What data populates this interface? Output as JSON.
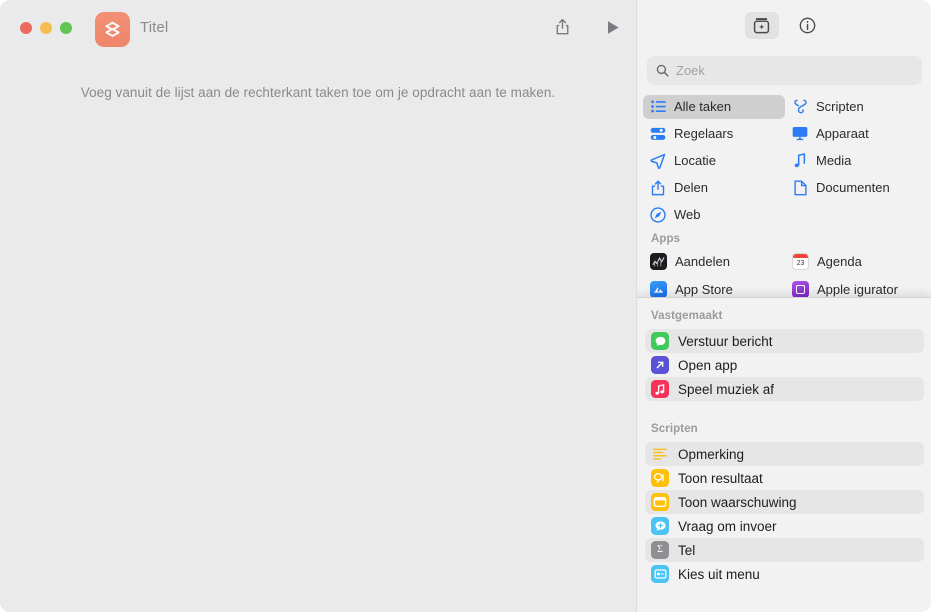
{
  "window": {
    "document_title": "Titel",
    "app_icon_name": "shortcuts-app-icon",
    "traffic_lights": [
      "close",
      "minimize",
      "zoom"
    ],
    "accent_colors": {
      "app_icon": "#ef8a70",
      "category_icon_blue": "#2d7cf6",
      "selected_row": "#cfcfcf",
      "pane_background": "#f2f2f2",
      "editor_background": "#eaeaea"
    }
  },
  "editor": {
    "toolbar": {
      "share_label": "Deel",
      "play_label": "Voer uit"
    },
    "empty_hint": "Voeg vanuit de lijst aan de rechterkant taken toe om je opdracht aan te maken."
  },
  "library": {
    "toolbar": {
      "action_library_label": "Takenbibliotheek",
      "info_label": "Info"
    },
    "search": {
      "placeholder": "Zoek",
      "value": ""
    },
    "categories": [
      {
        "label": "Alle taken",
        "icon": "list-bullet-icon",
        "selected": true
      },
      {
        "label": "Scripten",
        "icon": "scripts-icon",
        "selected": false,
        "display": "Scripten"
      },
      {
        "label": "Regelaars",
        "icon": "sliders-icon",
        "selected": false
      },
      {
        "label": "Apparaat",
        "icon": "display-icon",
        "selected": false
      },
      {
        "label": "Locatie",
        "icon": "location-arrow-icon",
        "selected": false
      },
      {
        "label": "Media",
        "icon": "music-note-icon",
        "selected": false
      },
      {
        "label": "Delen",
        "icon": "share-icon",
        "selected": false
      },
      {
        "label": "Documenten",
        "icon": "document-icon",
        "selected": false
      },
      {
        "label": "Web",
        "icon": "safari-compass-icon",
        "selected": false
      }
    ],
    "categories_display": {
      "c0": "Alle taken",
      "c1": "Scripten",
      "c2": "Regelaars",
      "c3": "Apparaat",
      "c4": "Locatie",
      "c5": "Media",
      "c6": "Delen",
      "c7": "Documenten",
      "c8": "Web"
    },
    "apps_section": {
      "header": "Apps",
      "items": [
        {
          "label": "Aandelen",
          "icon": "stocks-app-icon",
          "color": "#1c1c1e"
        },
        {
          "label": "Agenda",
          "icon": "calendar-app-icon",
          "color": "#ffffff",
          "badge": "23"
        },
        {
          "label": "App Store",
          "icon": "app-store-app-icon",
          "color": "#1f86f8"
        },
        {
          "label": "Apple  igurator",
          "icon": "apple-configurator-app-icon",
          "color": "#8a30c9"
        }
      ]
    }
  },
  "popover": {
    "pinned": {
      "header": "Vastgemaakt",
      "items": [
        {
          "label": "Verstuur bericht",
          "icon": "messages-icon",
          "color": "#3ecb5b"
        },
        {
          "label": "Open app",
          "icon": "open-app-icon",
          "color": "#5b53d6"
        },
        {
          "label": "Speel muziek af",
          "icon": "music-app-icon",
          "color": "#f8315a"
        }
      ]
    },
    "scripts": {
      "header": "Scripten",
      "items": [
        {
          "label": "Opmerking",
          "icon": "comment-icon",
          "color": "transparent"
        },
        {
          "label": "Toon resultaat",
          "icon": "show-result-icon",
          "color": "#ffc107"
        },
        {
          "label": "Toon waarschuwing",
          "icon": "show-alert-icon",
          "color": "#ffc107"
        },
        {
          "label": "Vraag om invoer",
          "icon": "ask-input-icon",
          "color": "#4cc3f5"
        },
        {
          "label": "Tel",
          "icon": "count-sigma-icon",
          "color": "#8e8e93"
        },
        {
          "label": "Kies uit menu",
          "icon": "choose-menu-icon",
          "color": "#4cc3f5"
        }
      ]
    }
  }
}
